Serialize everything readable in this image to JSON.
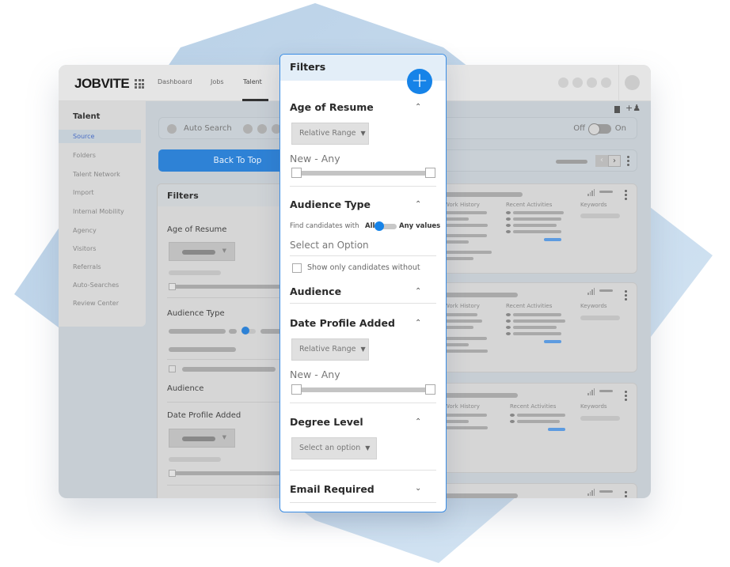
{
  "app": {
    "logo": "JOBVITE",
    "nav": [
      {
        "label": "Dashboard",
        "active": false
      },
      {
        "label": "Jobs",
        "active": false
      },
      {
        "label": "Talent",
        "active": true
      }
    ]
  },
  "sidebar": {
    "title": "Talent",
    "items": [
      {
        "label": "Source",
        "active": true
      },
      {
        "label": "Folders"
      },
      {
        "label": "Talent Network"
      },
      {
        "label": "Import"
      },
      {
        "label": "Internal Mobility"
      },
      {
        "label": "Agency"
      },
      {
        "label": "Visitors"
      },
      {
        "label": "Referrals"
      },
      {
        "label": "Auto-Searches"
      },
      {
        "label": "Review Center"
      }
    ]
  },
  "toolbar": {
    "auto_search_label": "Auto Search",
    "toggle_off_label": "Off",
    "toggle_on_label": "On",
    "back_to_top_label": "Back To Top",
    "pager_prev": "‹",
    "pager_next": "›"
  },
  "background_filters": {
    "title": "Filters",
    "sections": [
      "Age of Resume",
      "Audience Type",
      "Audience",
      "Date Profile Added"
    ]
  },
  "cards": {
    "work_history_label": "Work History",
    "recent_activities_label": "Recent Activities",
    "keywords_label": "Keywords"
  },
  "filters_panel": {
    "title": "Filters",
    "add_icon": "+",
    "accent_color": "#1683e8",
    "age_of_resume": {
      "heading": "Age of Resume",
      "select_value": "Relative Range",
      "range_label": "New - Any"
    },
    "audience_type": {
      "heading": "Audience Type",
      "find_label": "Find candidates with",
      "all_label": "All",
      "any_label": "Any values",
      "select_placeholder": "Select an Option",
      "checkbox_label": "Show only candidates without"
    },
    "audience": {
      "heading": "Audience"
    },
    "date_profile_added": {
      "heading": "Date Profile Added",
      "select_value": "Relative Range",
      "range_label": "New - Any"
    },
    "degree_level": {
      "heading": "Degree Level",
      "select_value": "Select an option"
    },
    "email_required": {
      "heading": "Email Required"
    }
  }
}
